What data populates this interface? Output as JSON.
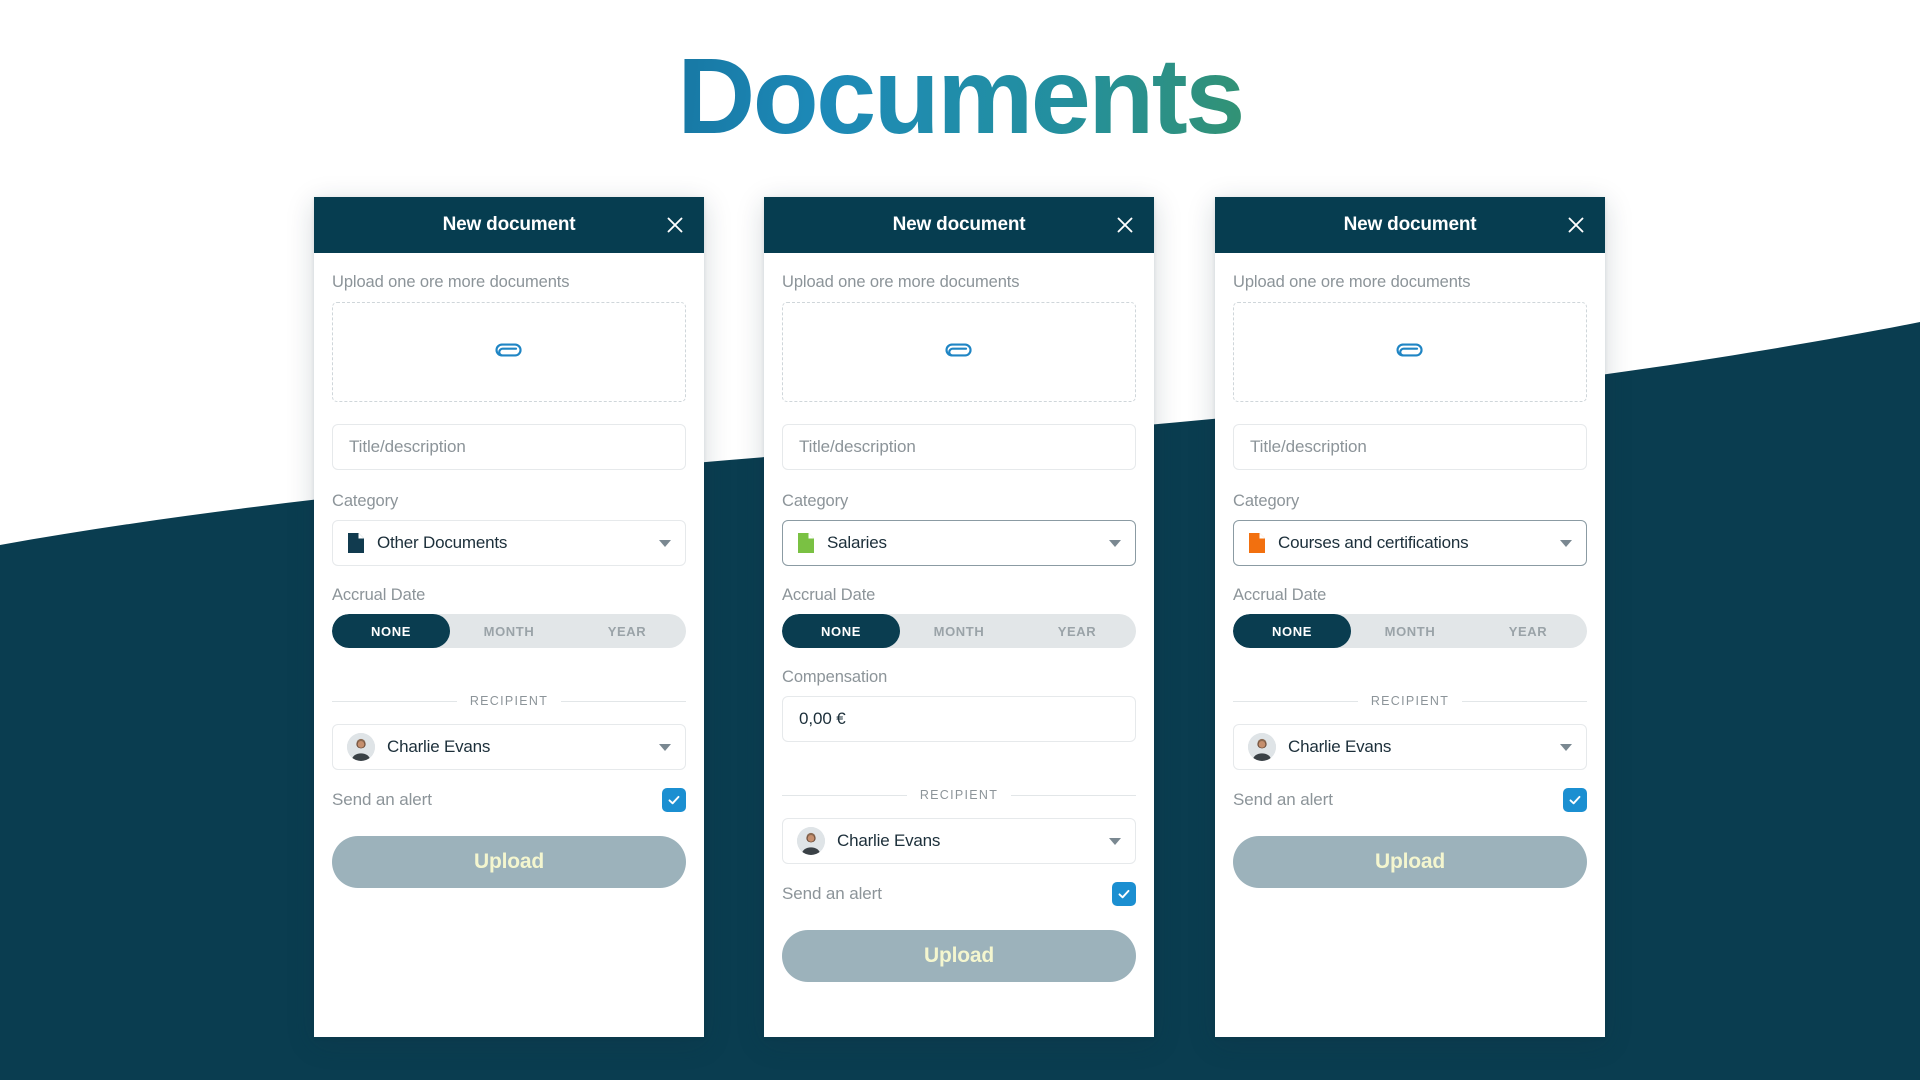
{
  "page": {
    "title": "Documents",
    "background_color": "#0a3d50",
    "title_gradient_start": "#0b3d4f",
    "title_gradient_end": "#8cc63f"
  },
  "common": {
    "header_title": "New document",
    "close_icon": "close-icon",
    "upload_hint": "Upload one ore more documents",
    "dropzone_icon": "paperclip-icon",
    "title_placeholder": "Title/description",
    "category_label": "Category",
    "accrual_label": "Accrual Date",
    "accrual_options": [
      "NONE",
      "MONTH",
      "YEAR"
    ],
    "accrual_selected": "NONE",
    "recipient_divider": "RECIPIENT",
    "recipient_name": "Charlie Evans",
    "alert_label": "Send an alert",
    "alert_checked": true,
    "check_icon": "check-icon",
    "upload_button": "Upload",
    "caret_icon": "chevron-down-icon",
    "avatar_icon": "avatar",
    "checkbox_color": "#1b8fd1",
    "upload_button_color": "#9cb2bb",
    "upload_button_text_color": "#f4f6cf",
    "header_color": "#063d50"
  },
  "cards": [
    {
      "id": "card-1",
      "category_value": "Other Documents",
      "category_icon_color": "#113b4f",
      "category_focused": false,
      "has_compensation": false
    },
    {
      "id": "card-2",
      "category_value": "Salaries",
      "category_icon_color": "#7ac143",
      "category_focused": true,
      "has_compensation": true,
      "compensation_label": "Compensation",
      "compensation_value": "0,00 €"
    },
    {
      "id": "card-3",
      "category_value": "Courses and certifications",
      "category_icon_color": "#f2700f",
      "category_focused": true,
      "has_compensation": false
    }
  ]
}
